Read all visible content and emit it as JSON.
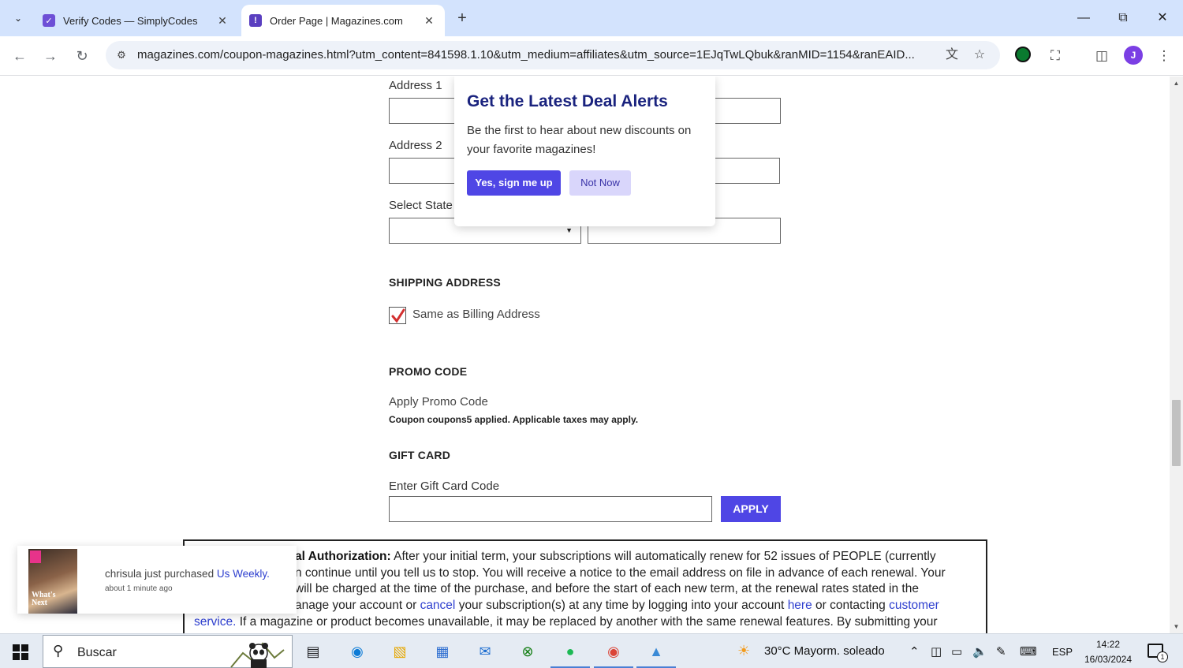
{
  "browser": {
    "tabs": [
      {
        "title": "Verify Codes — SimplyCodes",
        "active": false
      },
      {
        "title": "Order Page | Magazines.com",
        "active": true
      }
    ],
    "url": "magazines.com/coupon-magazines.html?utm_content=841598.1.10&utm_medium=affiliates&utm_source=1EJqTwLQbuk&ranMID=1154&ranEAID...",
    "profile_initial": "J"
  },
  "form": {
    "address1_label": "Address 1",
    "address2_label": "Address 2",
    "state_label": "Select State",
    "shipping_heading": "SHIPPING ADDRESS",
    "same_as_billing_label": "Same as Billing Address",
    "same_as_billing_checked": true,
    "promo_heading": "PROMO CODE",
    "promo_link": "Apply Promo Code",
    "promo_note": "Coupon coupons5 applied. Applicable taxes may apply.",
    "gift_heading": "GIFT CARD",
    "gift_label": "Enter Gift Card Code",
    "apply_label": "APPLY"
  },
  "terms": {
    "bold": "al Authorization:",
    "line1": "After your initial term, your subscriptions will automatically renew for 52 issues of PEOPLE (currently",
    "line2": "n continue until you tell us to stop. You will receive a notice to the email address on file in advance of each renewal. Your",
    "line3": "will be charged at the time of the purchase, and before the start of each new term, at the renewal rates stated in the",
    "line4_pre": "anage your account or",
    "cancel_link": "cancel",
    "line4_mid": "your subscription(s) at any time by logging into your account",
    "here_link": "here",
    "line4_post": "or contacting",
    "customer_link": "customer",
    "service_link": "service.",
    "line5": "If a magazine or product becomes unavailable, it may be replaced by another with the same renewal features. By submitting your"
  },
  "popup": {
    "title": "Get the Latest Deal Alerts",
    "text": "Be the first to hear about new discounts on your favorite magazines!",
    "yes_label": "Yes, sign me up",
    "no_label": "Not Now"
  },
  "purchase_notice": {
    "prefix": "chrisula just purchased",
    "product": "Us Weekly.",
    "time": "about 1 minute ago",
    "cover_text": "What's Next"
  },
  "taskbar": {
    "search_placeholder": "Buscar",
    "weather": "30°C  Mayorm. soleado",
    "language": "ESP",
    "time": "14:22",
    "date": "16/03/2024",
    "notification_count": "1"
  },
  "colors": {
    "accent": "#4f46e5",
    "popup_title": "#1a237e",
    "link": "#2e3fcf",
    "checkbox_mark": "#d32f2f"
  }
}
